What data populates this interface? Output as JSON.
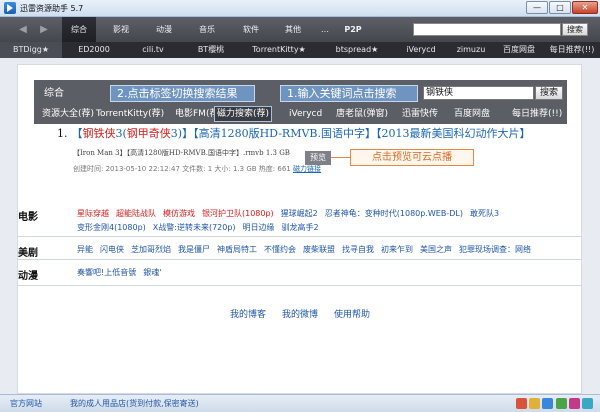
{
  "window": {
    "title": "迅雷资源助手 5.7",
    "min": "—",
    "max": "□",
    "close": "✕"
  },
  "nav": {
    "back": "◀",
    "forward": "▶",
    "tabs": [
      "综合",
      "影视",
      "动漫",
      "音乐",
      "软件",
      "其他",
      "…",
      "P2P"
    ],
    "search_button": "搜索"
  },
  "sites": [
    "BTDigg★",
    "ED2000",
    "cili.tv",
    "BT樱桃",
    "TorrentKitty★",
    "btspread★",
    "iVerycd",
    "zimuzu",
    "百度网盘",
    "每日推荐(!!)"
  ],
  "demo": {
    "combined_label": "综合",
    "callout_tabs": "2.点击标签切换搜索结果",
    "callout_search": "1.输入关键词点击搜索",
    "search_value": "钢铁侠",
    "search_button": "搜索",
    "tabs": [
      "资源大全(荐)",
      "TorrentKitty(荐)",
      "电影FM(荐)",
      "磁力搜索(荐)",
      "iVerycd",
      "唐老鼠(弹窗)",
      "迅雷快传",
      "百度网盘",
      "每日推荐(!!)"
    ]
  },
  "result": {
    "number": "1.",
    "title_pre": "【",
    "title_hl1": "钢铁侠",
    "title_mid1": "3(",
    "title_hl2": "钢甲奇侠",
    "title_mid2": "3)】【高清1280版HD-RMVB.国语中字】【2013最新美国科幻动作大片】",
    "file": "【Iron Man 3】【高清1280版HD-RMVB.国语中字】.rmvb 1.3 GB",
    "meta": "创建时间: 2013-05-10 22:12:47  文件数: 1  大小: 1.3 GB  热度: 661 ",
    "meta_link": "磁力链接",
    "preview_button": "预览",
    "preview_callout": "点击预览可云点播"
  },
  "categories": {
    "movie": {
      "label": "电影",
      "red_items": [
        "星际穿越",
        "超能陆战队",
        "模仿游戏",
        "银河护卫队(1080p)"
      ],
      "blue_items": [
        "猩球崛起2",
        "忍者神龟：变种时代(1080p.WEB-DL)",
        "敢死队3",
        "变形金刚4(1080p)",
        "X战警:逆转未来(720p)",
        "明日边缘",
        "驯龙高手2"
      ]
    },
    "tv": {
      "label": "美剧",
      "items": [
        "异能",
        "闪电侠",
        "芝加哥烈焰",
        "我是僵尸",
        "神盾局特工",
        "不懂约会",
        "废柴联盟",
        "找寻自我",
        "初来乍到",
        "美国之声",
        "犯罪现场调查：网络"
      ]
    },
    "anime": {
      "label": "动漫",
      "items": [
        "奏響吧!上低音號",
        "銀魂'"
      ]
    }
  },
  "footer_links": [
    "我的博客",
    "我的微博",
    "使用帮助"
  ],
  "status": {
    "site_link": "官方网站",
    "ad_link": "我的成人用品店(货到付款,保密寄送)"
  }
}
